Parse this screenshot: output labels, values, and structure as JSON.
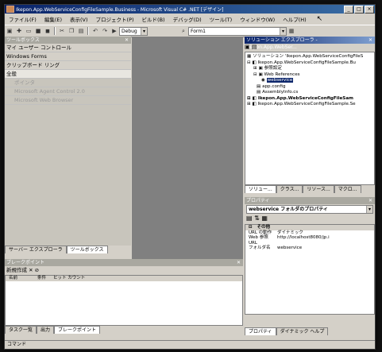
{
  "window": {
    "title": "Ikepon.App.WebServiceConfigFileSample.Business - Microsoft Visual C# .NET [デザイン]"
  },
  "menu": [
    "ファイル(F)",
    "編集(E)",
    "表示(V)",
    "プロジェクト(P)",
    "ビルド(B)",
    "デバッグ(D)",
    "ツール(T)",
    "ウィンドウ(W)",
    "ヘルプ(H)"
  ],
  "toolbar": {
    "config": "Debug",
    "form": "Form1"
  },
  "toolbox": {
    "title": "ツールボックス",
    "sections": [
      "マイ ユーザー コントロール",
      "Windows Forms",
      "クリップボード リング",
      "全般"
    ],
    "items": [
      "ポインタ",
      "Microsoft Agent Control 2.0",
      "Microsoft Web Browser"
    ],
    "tabs": [
      "サーバー エクスプローラ",
      "ツールボックス"
    ]
  },
  "breakpoints": {
    "title": "ブレークポイント",
    "toolbar": "新規作成",
    "cols": [
      "名前",
      "条件",
      "ヒット カウント"
    ],
    "tabs": [
      "タスク一覧",
      "出力",
      "ブレークポイント"
    ]
  },
  "solution": {
    "title": "ソリューション エクスプローラ - Ikepon.App.WebSer...",
    "tree": [
      "ソリューション 'Ikepon.App.WebServiceConfigFileS",
      "Ikepon.App.WebServiceConfigFileSample.Bu",
      "参照設定",
      "Web References",
      "webservice",
      "app.config",
      "AssemblyInfo.cs",
      "Ikepon.App.WebServiceConfigFileSam",
      "Ikepon.App.WebServiceConfigFileSample.Se"
    ],
    "tabs": [
      "ソリュー...",
      "クラス...",
      "リソース...",
      "マクロ..."
    ]
  },
  "properties": {
    "title": "プロパティ",
    "object": "webservice フォルダのプロパティ",
    "category": "その他",
    "rows": [
      {
        "name": "URL の動作",
        "value": "ダイナミック"
      },
      {
        "name": "Web 参照 URL",
        "value": "http://localhost8080/jp.i"
      },
      {
        "name": "フォルダ名",
        "value": "webservice"
      }
    ],
    "tabs": [
      "プロパティ",
      "ダイナミック ヘルプ"
    ]
  },
  "status": "コマンド"
}
